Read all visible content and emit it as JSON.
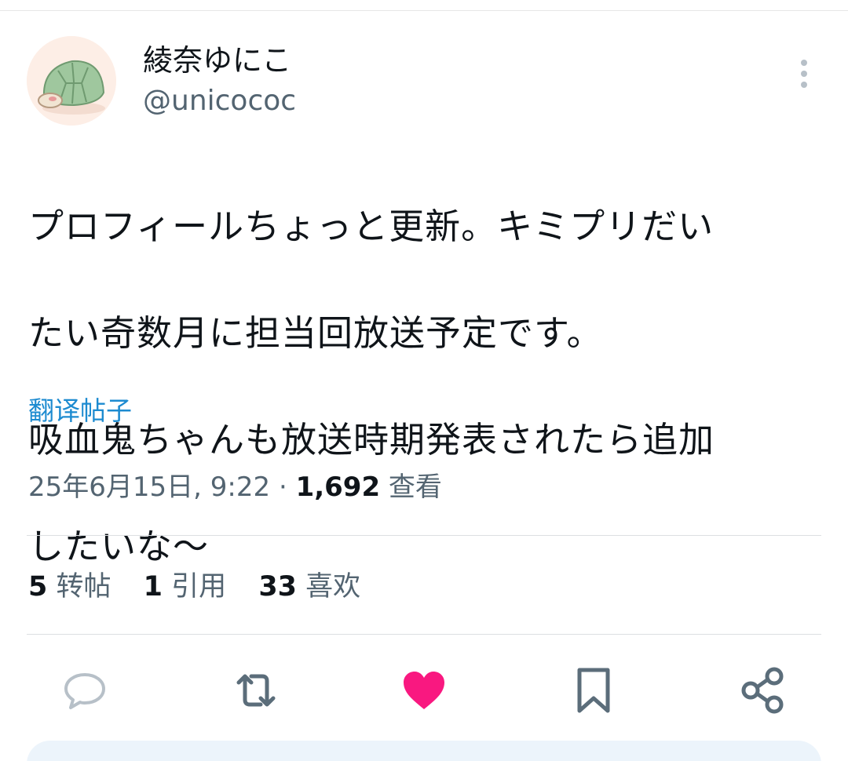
{
  "user": {
    "display_name": "綾奈ゆにこ",
    "handle": "@unicococ"
  },
  "tweet": {
    "lines": [
      "プロフィールちょっと更新。キミプリだい",
      "たい奇数月に担当回放送予定です。",
      "吸血鬼ちゃんも放送時期発表されたら追加",
      "したいな〜"
    ],
    "translate_label": "翻译帖子",
    "date": "25年6月15日, 9:22",
    "separator": "·",
    "views_count": "1,692",
    "views_label": "查看"
  },
  "stats": {
    "retweets_count": "5",
    "retweets_label": "转帖",
    "quotes_count": "1",
    "quotes_label": "引用",
    "likes_count": "33",
    "likes_label": "喜欢"
  },
  "icons": {
    "avatar": "turtle-avatar",
    "more": "more-vertical-icon",
    "reply": "reply-icon",
    "retweet": "retweet-icon",
    "like": "heart-icon",
    "bookmark": "bookmark-icon",
    "share": "share-icon"
  },
  "colors": {
    "like_active": "#f91880",
    "link": "#1d8bd0",
    "secondary_text": "#536471"
  },
  "state": {
    "liked": true
  }
}
